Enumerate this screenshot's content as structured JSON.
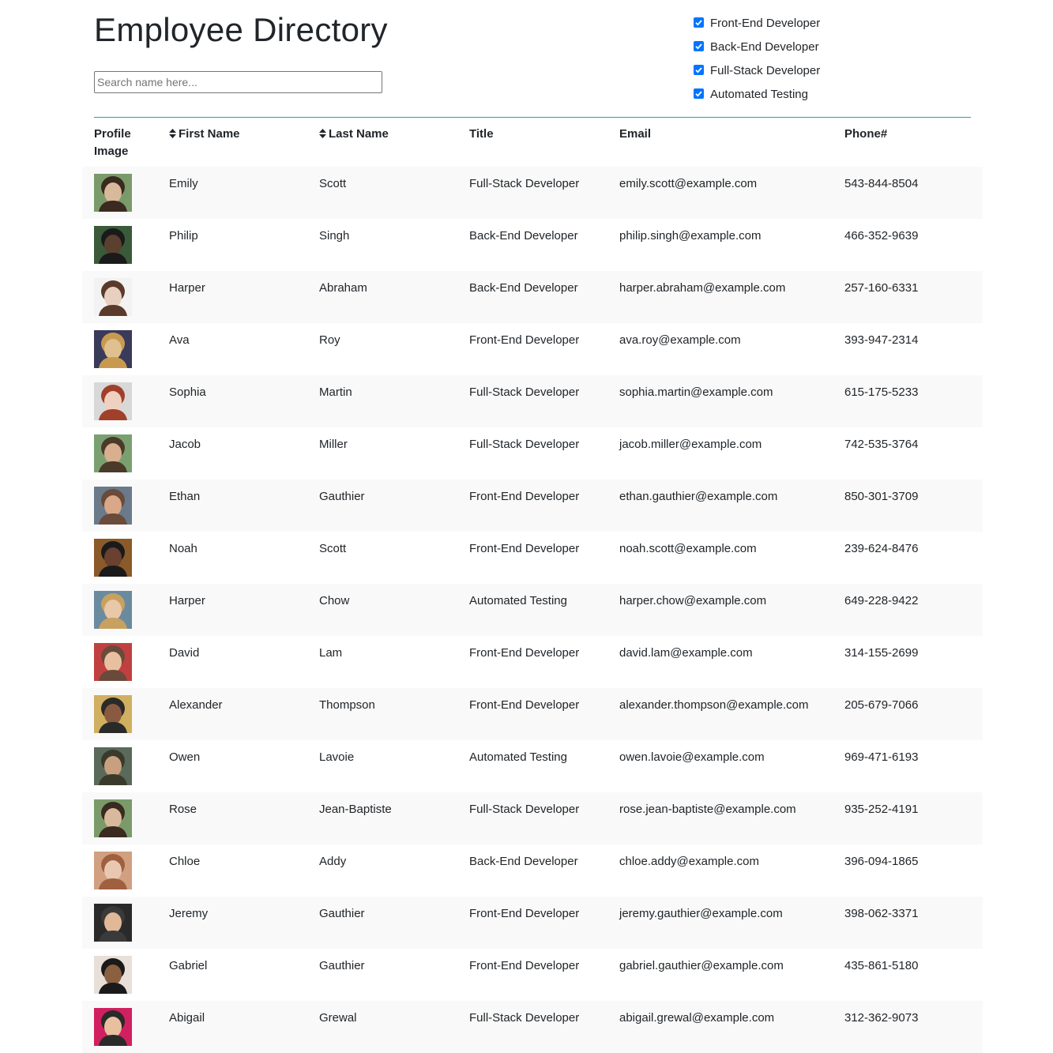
{
  "page": {
    "title": "Employee Directory"
  },
  "search": {
    "placeholder": "Search name here..."
  },
  "filters": [
    {
      "label": "Front-End Developer",
      "checked": true
    },
    {
      "label": "Back-End Developer",
      "checked": true
    },
    {
      "label": "Full-Stack Developer",
      "checked": true
    },
    {
      "label": "Automated Testing",
      "checked": true
    }
  ],
  "colors": {
    "accent_line": "#17a2b8",
    "checkbox": "#0075ff",
    "stripe": "#f9f9f9"
  },
  "table": {
    "headers": {
      "profile_image": "Profile Image",
      "first_name": "First Name",
      "last_name": "Last Name",
      "title": "Title",
      "email": "Email",
      "phone": "Phone#"
    },
    "sort_icon": "sort-icon",
    "rows": [
      {
        "first": "Emily",
        "last": "Scott",
        "title": "Full-Stack Developer",
        "email": "emily.scott@example.com",
        "phone": "543-844-8504"
      },
      {
        "first": "Philip",
        "last": "Singh",
        "title": "Back-End Developer",
        "email": "philip.singh@example.com",
        "phone": "466-352-9639"
      },
      {
        "first": "Harper",
        "last": "Abraham",
        "title": "Back-End Developer",
        "email": "harper.abraham@example.com",
        "phone": "257-160-6331"
      },
      {
        "first": "Ava",
        "last": "Roy",
        "title": "Front-End Developer",
        "email": "ava.roy@example.com",
        "phone": "393-947-2314"
      },
      {
        "first": "Sophia",
        "last": "Martin",
        "title": "Full-Stack Developer",
        "email": "sophia.martin@example.com",
        "phone": "615-175-5233"
      },
      {
        "first": "Jacob",
        "last": "Miller",
        "title": "Full-Stack Developer",
        "email": "jacob.miller@example.com",
        "phone": "742-535-3764"
      },
      {
        "first": "Ethan",
        "last": "Gauthier",
        "title": "Front-End Developer",
        "email": "ethan.gauthier@example.com",
        "phone": "850-301-3709"
      },
      {
        "first": "Noah",
        "last": "Scott",
        "title": "Front-End Developer",
        "email": "noah.scott@example.com",
        "phone": "239-624-8476"
      },
      {
        "first": "Harper",
        "last": "Chow",
        "title": "Automated Testing",
        "email": "harper.chow@example.com",
        "phone": "649-228-9422"
      },
      {
        "first": "David",
        "last": "Lam",
        "title": "Front-End Developer",
        "email": "david.lam@example.com",
        "phone": "314-155-2699"
      },
      {
        "first": "Alexander",
        "last": "Thompson",
        "title": "Front-End Developer",
        "email": "alexander.thompson@example.com",
        "phone": "205-679-7066"
      },
      {
        "first": "Owen",
        "last": "Lavoie",
        "title": "Automated Testing",
        "email": "owen.lavoie@example.com",
        "phone": "969-471-6193"
      },
      {
        "first": "Rose",
        "last": "Jean-Baptiste",
        "title": "Full-Stack Developer",
        "email": "rose.jean-baptiste@example.com",
        "phone": "935-252-4191"
      },
      {
        "first": "Chloe",
        "last": "Addy",
        "title": "Back-End Developer",
        "email": "chloe.addy@example.com",
        "phone": "396-094-1865"
      },
      {
        "first": "Jeremy",
        "last": "Gauthier",
        "title": "Front-End Developer",
        "email": "jeremy.gauthier@example.com",
        "phone": "398-062-3371"
      },
      {
        "first": "Gabriel",
        "last": "Gauthier",
        "title": "Front-End Developer",
        "email": "gabriel.gauthier@example.com",
        "phone": "435-861-5180"
      },
      {
        "first": "Abigail",
        "last": "Grewal",
        "title": "Full-Stack Developer",
        "email": "abigail.grewal@example.com",
        "phone": "312-362-9073"
      }
    ]
  }
}
